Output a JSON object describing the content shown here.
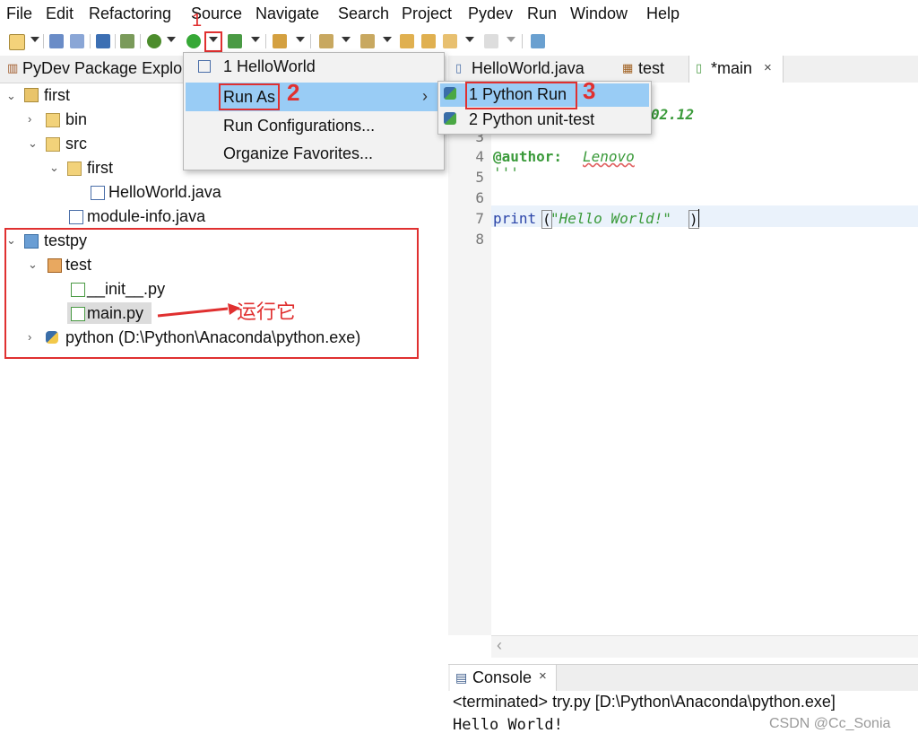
{
  "menubar": {
    "items": [
      "File",
      "Edit",
      "Refactoring",
      "Source",
      "Navigate",
      "Search",
      "Project",
      "Pydev",
      "Run",
      "Window",
      "Help"
    ]
  },
  "left_pane": {
    "tab_label": "PyDev Package Explo",
    "tree": {
      "first": "first",
      "bin": "bin",
      "src": "src",
      "first_pkg": "first",
      "helloworld_java": "HelloWorld.java",
      "module_info": "module-info.java",
      "testpy": "testpy",
      "test": "test",
      "init_py": "__init__.py",
      "main_py": "main.py",
      "python_interp": "python  (D:\\Python\\Anaconda\\python.exe)"
    }
  },
  "run_menu": {
    "items": [
      "1 HelloWorld",
      "Run As",
      "Run Configurations...",
      "Organize Favorites..."
    ]
  },
  "run_as_submenu": {
    "items": [
      "1 Python Run",
      "2 Python unit-test"
    ]
  },
  "editor": {
    "tabs": [
      "HelloWorld.java",
      "test",
      "*main"
    ],
    "line_numbers": [
      "3",
      "4",
      "5",
      "6",
      "7",
      "8"
    ],
    "partial_text": "02.12",
    "author_key": "@author:",
    "author_value": "Lenovo",
    "docstring_close": "'''",
    "code_print": "print",
    "code_paren_open": "(",
    "code_string": "\"Hello World!\"",
    "code_paren_close": ")"
  },
  "console": {
    "tab_label": "Console",
    "status": "<terminated> try.py [D:\\Python\\Anaconda\\python.exe]",
    "output": "Hello World!"
  },
  "annotations": {
    "marker_1": "1",
    "marker_2": "2",
    "marker_3": "3",
    "run_it": "运行它",
    "color": "#e03030"
  },
  "watermark": "CSDN @Cc_Sonia"
}
